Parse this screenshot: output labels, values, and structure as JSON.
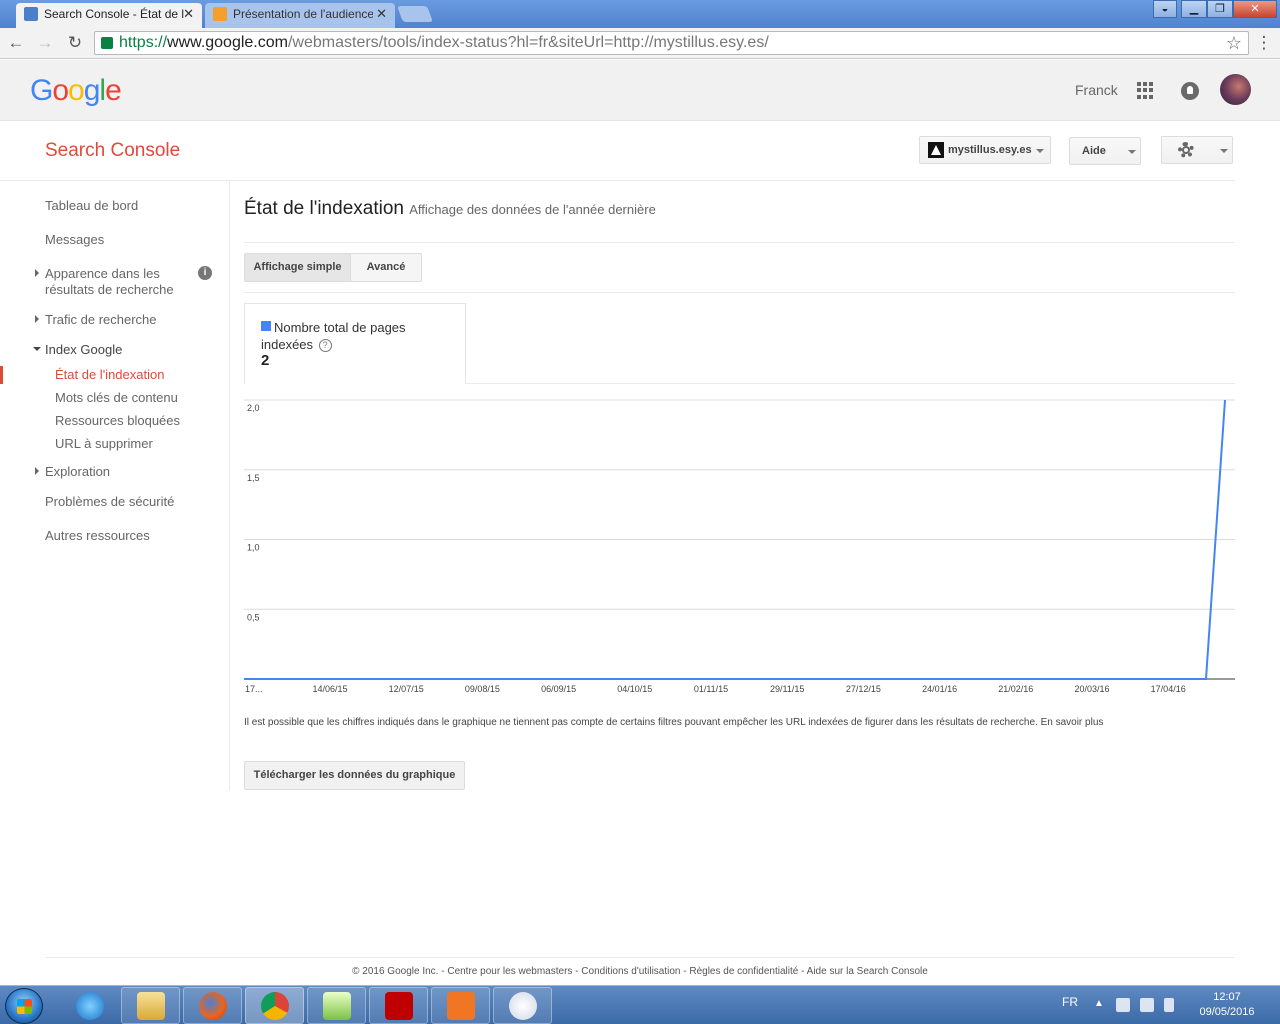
{
  "browser": {
    "tabs": [
      {
        "label": "Search Console - État de l",
        "active": true
      },
      {
        "label": "Présentation de l'audience",
        "active": false
      }
    ],
    "url": {
      "scheme": "https://",
      "host": "www.google.com",
      "path": "/webmasters/tools/index-status?hl=fr&siteUrl=http://mystillus.esy.es/"
    }
  },
  "header": {
    "logo_letters": [
      "G",
      "o",
      "o",
      "g",
      "l",
      "e"
    ],
    "username": "Franck"
  },
  "console": {
    "title": "Search Console",
    "site": "mystillus.esy.es",
    "help_label": "Aide"
  },
  "sidebar": {
    "items": [
      {
        "label": "Tableau de bord"
      },
      {
        "label": "Messages"
      },
      {
        "label": "Apparence dans les résultats de recherche"
      },
      {
        "label": "Trafic de recherche"
      },
      {
        "label": "Index Google"
      },
      {
        "label": "État de l'indexation"
      },
      {
        "label": "Mots clés de contenu"
      },
      {
        "label": "Ressources bloquées"
      },
      {
        "label": "URL à supprimer"
      },
      {
        "label": "Exploration"
      },
      {
        "label": "Problèmes de sécurité"
      },
      {
        "label": "Autres ressources"
      }
    ]
  },
  "main": {
    "title": "État de l'indexation",
    "subtitle": "Affichage des données de l'année dernière",
    "view_simple": "Affichage simple",
    "view_advanced": "Avancé",
    "metric_label": "Nombre total de pages indexées",
    "metric_value": "2",
    "note": "Il est possible que les chiffres indiqués dans le graphique ne tiennent pas compte de certains filtres pouvant empêcher les URL indexées de figurer dans les résultats de recherche. En savoir plus",
    "download_label": "Télécharger les données du graphique"
  },
  "chart_data": {
    "type": "line",
    "series_color": "#4285f4",
    "ylim": [
      0,
      2
    ],
    "y_ticks": [
      "0,5",
      "1,0",
      "1,5",
      "2,0"
    ],
    "y_tick_values": [
      0.5,
      1.0,
      1.5,
      2.0
    ],
    "x_tick_labels": [
      "17...",
      "14/06/15",
      "12/07/15",
      "09/08/15",
      "06/09/15",
      "04/10/15",
      "01/11/15",
      "29/11/15",
      "27/12/15",
      "24/01/16",
      "21/02/16",
      "20/03/16",
      "17/04/16"
    ],
    "x": [
      "17/05/15",
      "14/06/15",
      "12/07/15",
      "09/08/15",
      "06/09/15",
      "04/10/15",
      "01/11/15",
      "29/11/15",
      "27/12/15",
      "24/01/16",
      "21/02/16",
      "20/03/16",
      "17/04/16",
      "01/05/16",
      "08/05/16"
    ],
    "values": [
      0,
      0,
      0,
      0,
      0,
      0,
      0,
      0,
      0,
      0,
      0,
      0,
      0,
      0,
      2
    ],
    "grid": true,
    "legend": "none"
  },
  "footer": {
    "text": "© 2016 Google Inc. - Centre pour les webmasters - Conditions d'utilisation - Règles de confidentialité - Aide sur la Search Console"
  },
  "taskbar": {
    "language": "FR",
    "time": "12:07",
    "date": "09/05/2016",
    "apps": [
      "internet-explorer",
      "file-explorer",
      "firefox",
      "chrome",
      "notepad-plus-plus",
      "filezilla",
      "xampp",
      "paint"
    ]
  }
}
